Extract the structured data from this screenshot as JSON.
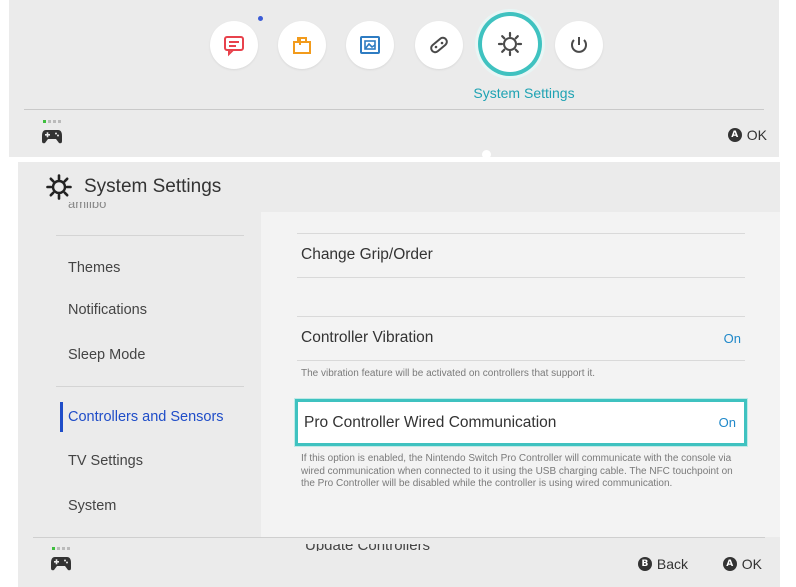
{
  "home": {
    "icons": [
      {
        "name": "news-icon",
        "color": "#e8424c",
        "has_new_badge": true
      },
      {
        "name": "eshop-icon",
        "color": "#f29b1c"
      },
      {
        "name": "album-icon",
        "color": "#2e7cc2"
      },
      {
        "name": "controllers-icon",
        "color": "#4a4a4a"
      },
      {
        "name": "system-settings-icon",
        "color": "#4a4a4a",
        "selected": true
      },
      {
        "name": "power-icon",
        "color": "#4a4a4a"
      }
    ],
    "selected_caption": "System Settings",
    "footer": {
      "ok_glyph": "A",
      "ok_label": "OK"
    }
  },
  "settings": {
    "title": "System Settings",
    "sidebar_peek": "amiibo",
    "sidebar": [
      {
        "label": "Themes"
      },
      {
        "label": "Notifications"
      },
      {
        "label": "Sleep Mode"
      },
      {
        "label": "Controllers and Sensors",
        "active": true
      },
      {
        "label": "TV Settings"
      },
      {
        "label": "System"
      }
    ],
    "content": {
      "change_grip": "Change Grip/Order",
      "vibration": {
        "label": "Controller Vibration",
        "value": "On",
        "description": "The vibration feature will be activated on controllers that support it."
      },
      "pro_wired": {
        "label": "Pro Controller Wired Communication",
        "value": "On",
        "description": "If this option is enabled, the Nintendo Switch Pro Controller will communicate with the console via wired communication when connected to it using the USB charging cable. The NFC touchpoint on the Pro Controller will be disabled while the controller is using wired communication."
      },
      "next_peek": "Update Controllers"
    },
    "footer": {
      "back_glyph": "B",
      "back_label": "Back",
      "ok_glyph": "A",
      "ok_label": "OK"
    }
  },
  "colors": {
    "accent": "#3fc2c0",
    "active_text": "#1f4dc8",
    "value_text": "#1f88c9"
  }
}
